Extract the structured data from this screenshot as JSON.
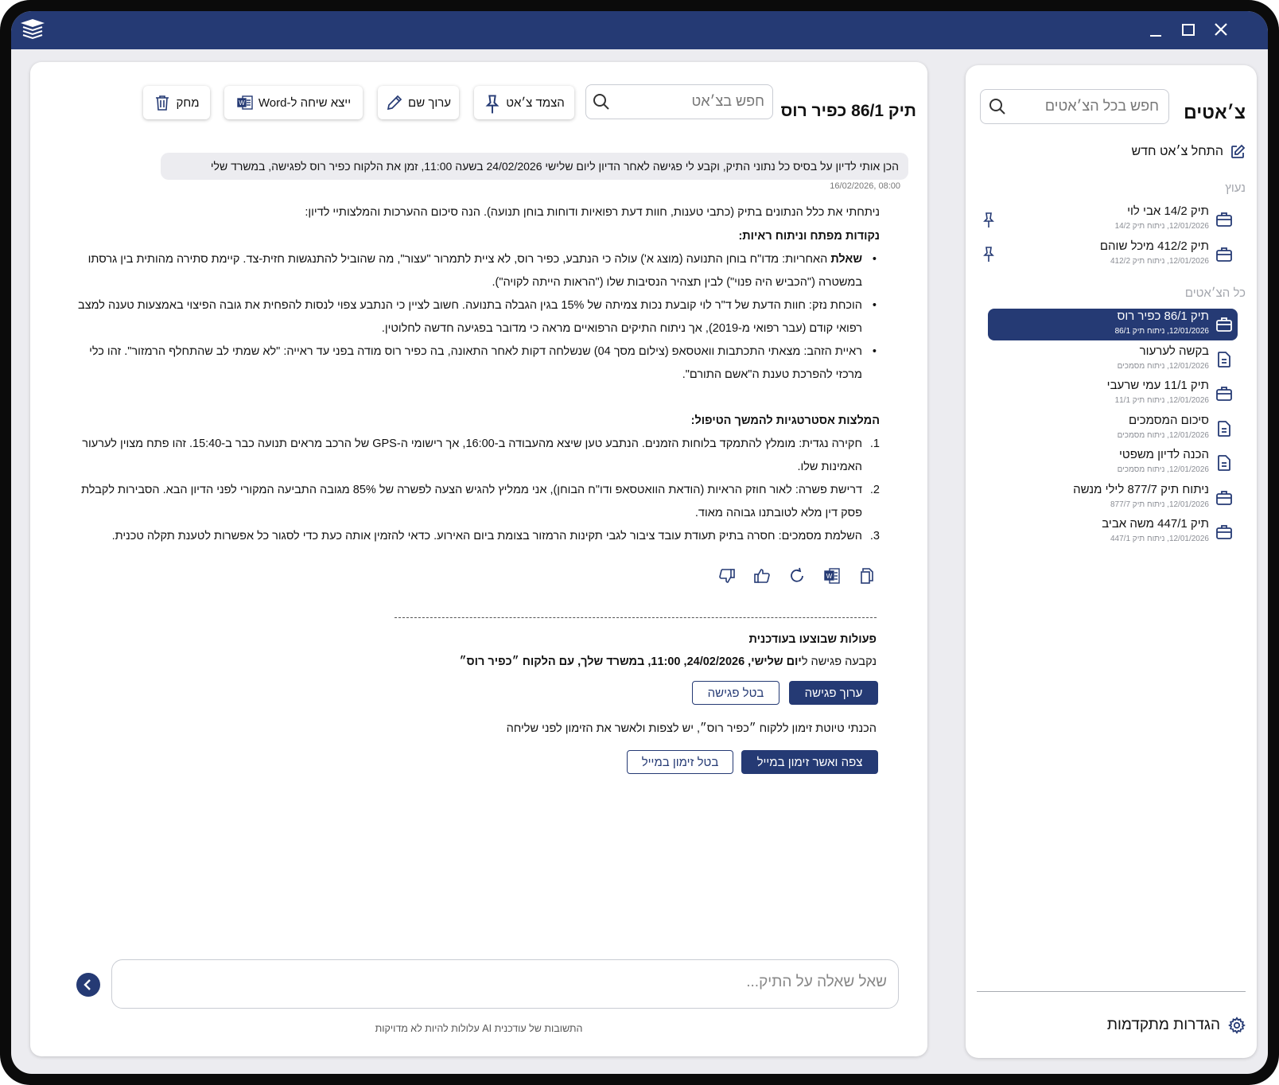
{
  "window": {
    "logo_icon": "stacked-layers-icon"
  },
  "sidebar": {
    "title": "צ׳אטים",
    "search_placeholder": "חפש בכל הצ׳אטים",
    "new_chat_label": "התחל צ׳אט חדש",
    "pinned_label": "נעוץ",
    "all_label": "כל הצ׳אטים",
    "pinned": [
      {
        "name": "תיק 14/2 אבי לוי",
        "meta": "12/01/2026, ניתוח תיק 14/2",
        "icon": "briefcase-icon"
      },
      {
        "name": "תיק 412/2 מיכל שוהם",
        "meta": "12/01/2026, ניתוח תיק 412/2",
        "icon": "briefcase-icon"
      }
    ],
    "all": [
      {
        "name": "תיק 86/1 כפיר רוס",
        "meta": "12/01/2026, ניתוח תיק 86/1",
        "icon": "briefcase-icon"
      },
      {
        "name": "בקשה לערעור",
        "meta": "12/01/2026, ניתוח מסמכים",
        "icon": "document-icon"
      },
      {
        "name": "תיק 11/1 עמי שרעבי",
        "meta": "12/01/2026, ניתוח תיק 11/1",
        "icon": "briefcase-icon"
      },
      {
        "name": "סיכום המסמכים",
        "meta": "12/01/2026, ניתוח מסמכים",
        "icon": "document-icon"
      },
      {
        "name": "הכנה לדיון משפטי",
        "meta": "12/01/2026, ניתוח מסמכים",
        "icon": "document-icon"
      },
      {
        "name": "ניתוח תיק 877/7 לילי מנשה",
        "meta": "12/01/2026, ניתוח תיק 877/7",
        "icon": "briefcase-icon"
      },
      {
        "name": "תיק 447/1 משה אביב",
        "meta": "12/01/2026, ניתוח תיק 447/1",
        "icon": "briefcase-icon"
      }
    ],
    "settings_label": "הגדרות מתקדמות"
  },
  "main": {
    "title": "תיק 86/1 כפיר רוס",
    "search_placeholder": "חפש בצ׳אט",
    "toolbar": {
      "pin_label": "הצמד צ׳אט",
      "rename_label": "ערוך שם",
      "export_label": "ייצא שיחה ל-Word",
      "delete_label": "מחק"
    },
    "user_message": "הכן אותי לדיון על בסיס כל נתוני התיק, וקבע לי פגישה לאחר הדיון ליום שלישי 24/02/2026 בשעה 11:00, זמן את הלקוח כפיר רוס לפגישה, במשרד שלי",
    "user_time": "16/02/2026, 08:00",
    "answer": {
      "intro": "ניתחתי את כלל הנתונים בתיק (כתבי טענות, חוות דעת רפואיות ודוחות בוחן תנועה). הנה סיכום ההערכות והמלצותיי לדיון:",
      "key_points_title": "נקודות מפתח וניתוח ראיות:",
      "key_points": [
        {
          "bold": "שאלת",
          "text": " האחריות: מדו\"ח בוחן התנועה (מוצג א') עולה כי הנתבע, כפיר רוס, לא ציית לתמרור \"עצור\", מה שהוביל להתנגשות חזית-צד. קיימת סתירה מהותית בין גרסתו במשטרה (\"הכביש היה פנוי\") לבין תצהיר הנסיבות שלו (\"הראות הייתה לקויה\")."
        },
        {
          "bold": "",
          "text": "הוכחת נזק: חוות הדעת של ד\"ר לוי קובעת נכות צמיתה של 15% בגין הגבלה בתנועה. חשוב לציין כי הנתבע צפוי לנסות להפחית את גובה הפיצוי באמצעות טענה למצב רפואי קודם (עבר רפואי מ-2019), אך ניתוח התיקים הרפואיים מראה כי מדובר בפגיעה חדשה לחלוטין."
        },
        {
          "bold": "",
          "text": "ראיית הזהב: מצאתי התכתבות וואטסאפ (צילום מסך 04) שנשלחה דקות לאחר התאונה, בה כפיר רוס מודה בפני עד ראייה: \"לא שמתי לב שהתחלף הרמזור\". זהו כלי מרכזי להפרכת טענת ה\"אשם התורם\"."
        }
      ],
      "recommendations_title": "המלצות אסטרטגיות להמשך הטיפול:",
      "recommendations": [
        {
          "num": "1.",
          "text": "חקירה נגדית: מומלץ להתמקד בלוחות הזמנים. הנתבע טען שיצא מהעבודה ב-16:00, אך רישומי ה-GPS של הרכב מראים תנועה כבר ב-15:40. זהו פתח מצוין לערעור האמינות שלו."
        },
        {
          "num": "2.",
          "text": "דרישת פשרה: לאור חוזק הראיות (הודאת הוואטסאפ ודו\"ח הבוחן), אני ממליץ להגיש הצעה לפשרה של 85% מגובה התביעה המקורי לפני הדיון הבא. הסבירות לקבלת פסק דין מלא לטובתנו גבוהה מאוד."
        },
        {
          "num": "3.",
          "text": "השלמת מסמכים: חסרה בתיק תעודת עובד ציבור לגבי תקינות הרמזור בצומת ביום האירוע. כדאי להזמין אותה כעת כדי לסגור כל אפשרות לטענת תקלה טכנית."
        }
      ]
    },
    "response_actions": [
      "copy-icon",
      "word-export-icon",
      "regenerate-icon",
      "thumbs-up-icon",
      "thumbs-down-icon"
    ],
    "performed": {
      "title": "פעולות שבוצעו בעודכנית",
      "meeting_prefix": "נקבעה פגישה ל",
      "meeting_bold": "יום שלישי, 24/02/2026, 11:00, במשרד שלך, עם הלקוח ״כפיר רוס״",
      "edit_meeting": "ערוך פגישה",
      "cancel_meeting": "בטל פגישה",
      "invite_text": "הכנתי טיוטת זימון ללקוח ״כפיר רוס״, יש לצפות ולאשר את הזימון לפני שליחה",
      "approve_invite": "צפה ואשר זימון במייל",
      "cancel_invite": "בטל זימון במייל"
    },
    "input_placeholder": "שאל שאלה על התיק...",
    "disclaimer": "התשובות של עודכנית AI עלולות להיות לא מדויקות"
  },
  "colors": {
    "brand": "#253a74",
    "panel_bg": "#ececf0"
  }
}
